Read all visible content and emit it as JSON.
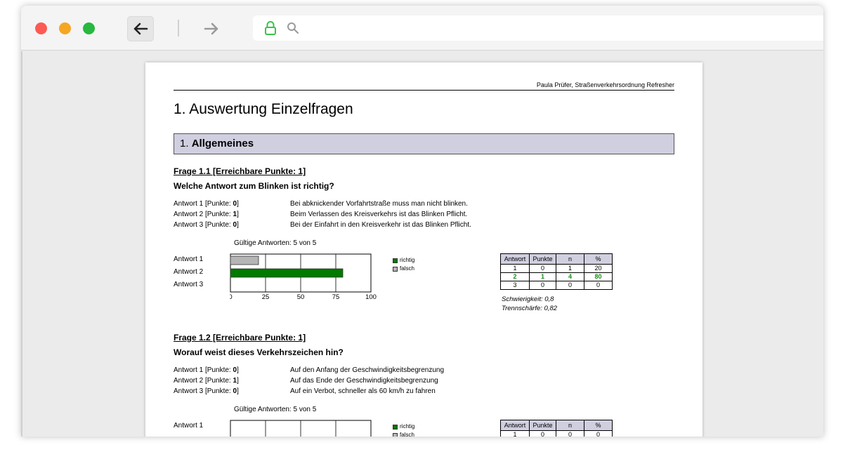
{
  "document": {
    "header": "Paula Prüfer, Straßenverkehrsordnung Refresher",
    "title": "1. Auswertung Einzelfragen",
    "section": {
      "number": "1.",
      "title": "Allgemeines"
    }
  },
  "questions": [
    {
      "title": "Frage 1.1 [Erreichbare Punkte: 1]",
      "question": "Welche Antwort zum Blinken ist richtig?",
      "answers": [
        {
          "label_prefix": "Antwort 1 [Punkte: ",
          "points": "0",
          "label_suffix": "]",
          "text": "Bei abknickender Vorfahrtstraße muss man nicht blinken."
        },
        {
          "label_prefix": "Antwort 2 [Punkte: ",
          "points": "1",
          "label_suffix": "]",
          "text": "Beim Verlassen des Kreisverkehrs ist das Blinken Pflicht."
        },
        {
          "label_prefix": "Antwort 3 [Punkte: ",
          "points": "0",
          "label_suffix": "]",
          "text": "Bei der Einfahrt in den Kreisverkehr ist das Blinken Pflicht."
        }
      ],
      "valid_answers": "Gültige Antworten: 5 von 5",
      "chart_data": {
        "type": "bar",
        "orientation": "horizontal",
        "categories": [
          "Antwort 1",
          "Antwort 2",
          "Antwort 3"
        ],
        "values": [
          20,
          80,
          0
        ],
        "bar_status": [
          "falsch",
          "richtig",
          "falsch"
        ],
        "xticks": [
          "0",
          "25",
          "50",
          "75",
          "100"
        ],
        "xlim": [
          0,
          100
        ],
        "legend": [
          "richtig",
          "falsch"
        ],
        "colors": {
          "richtig": "#007a00",
          "falsch": "#b5b5b5"
        }
      },
      "stats": {
        "headers": [
          "Antwort",
          "Punkte",
          "n",
          "%"
        ],
        "rows": [
          [
            "1",
            "0",
            "1",
            "20"
          ],
          [
            "2",
            "1",
            "4",
            "80"
          ],
          [
            "3",
            "0",
            "0",
            "0"
          ]
        ],
        "correct_row": 1
      },
      "difficulty": "Schwierigkeit: 0,8",
      "discrimination": "Trennschärfe: 0,82"
    },
    {
      "title": "Frage 1.2 [Erreichbare Punkte: 1]",
      "question": "Worauf weist dieses Verkehrszeichen hin?",
      "answers": [
        {
          "label_prefix": "Antwort 1 [Punkte: ",
          "points": "0",
          "label_suffix": "]",
          "text": "Auf den Anfang der Geschwindigkeitsbegrenzung"
        },
        {
          "label_prefix": "Antwort 2 [Punkte: ",
          "points": "1",
          "label_suffix": "]",
          "text": "Auf das Ende der Geschwindigkeitsbegrenzung"
        },
        {
          "label_prefix": "Antwort 3 [Punkte: ",
          "points": "0",
          "label_suffix": "]",
          "text": "Auf ein Verbot, schneller als 60 km/h zu fahren"
        }
      ],
      "valid_answers": "Gültige Antworten: 5 von 5",
      "chart_data": {
        "type": "bar",
        "orientation": "horizontal",
        "categories": [
          "Antwort 1"
        ],
        "values": [
          0
        ],
        "xlim": [
          0,
          100
        ],
        "legend": [
          "richtig",
          "falsch"
        ],
        "colors": {
          "richtig": "#007a00",
          "falsch": "#b5b5b5"
        }
      },
      "stats": {
        "headers": [
          "Antwort",
          "Punkte",
          "n",
          "%"
        ],
        "rows": [
          [
            "1",
            "0",
            "0",
            "0"
          ]
        ]
      }
    }
  ]
}
